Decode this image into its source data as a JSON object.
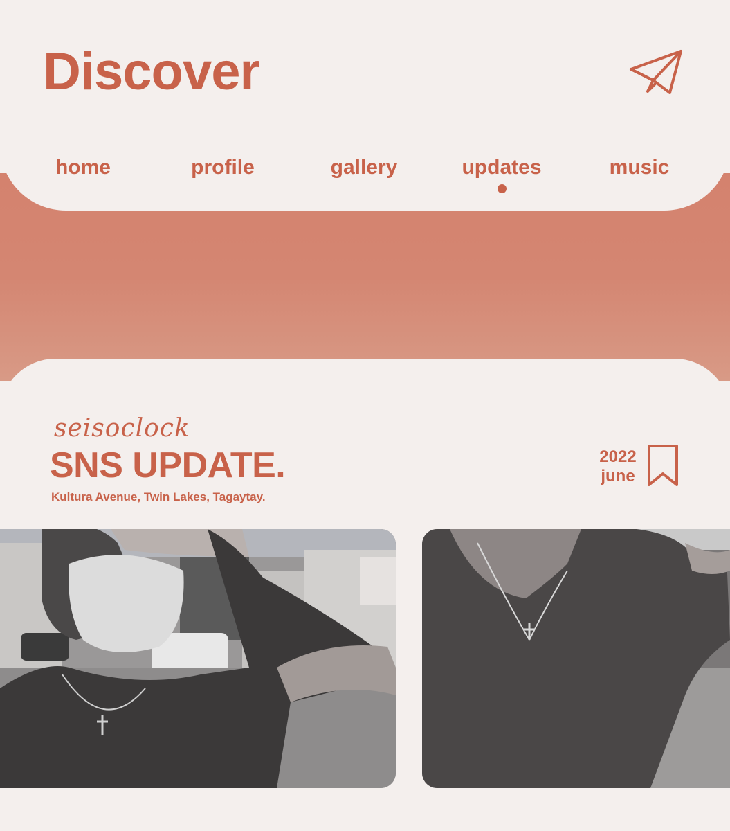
{
  "header": {
    "title": "Discover",
    "send_icon": "paper-plane-icon"
  },
  "nav": {
    "items": [
      {
        "label": "home",
        "active": false
      },
      {
        "label": "profile",
        "active": false
      },
      {
        "label": "gallery",
        "active": false
      },
      {
        "label": "updates",
        "active": true
      },
      {
        "label": "music",
        "active": false
      }
    ]
  },
  "post": {
    "script_label": "seisoclock",
    "title": "SNS UPDATE.",
    "location": "Kultura Avenue, Twin Lakes, Tagaytay.",
    "year": "2022",
    "month": "june",
    "bookmark_icon": "bookmark-icon"
  },
  "colors": {
    "accent": "#c8624a",
    "background": "#f4efed",
    "band": "#d4826e"
  }
}
